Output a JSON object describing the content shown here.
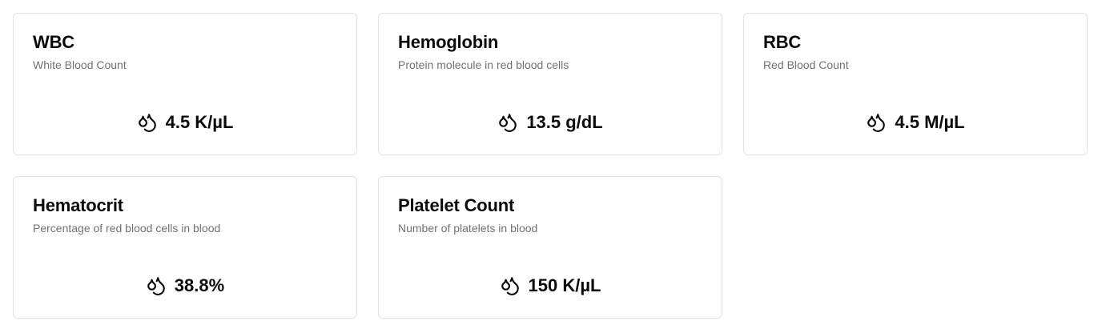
{
  "cards": [
    {
      "title": "WBC",
      "description": "White Blood Count",
      "value": "4.5 K/µL",
      "icon": "droplets-icon"
    },
    {
      "title": "Hemoglobin",
      "description": "Protein molecule in red blood cells",
      "value": "13.5 g/dL",
      "icon": "droplets-icon"
    },
    {
      "title": "RBC",
      "description": "Red Blood Count",
      "value": "4.5 M/µL",
      "icon": "droplets-icon"
    },
    {
      "title": "Hematocrit",
      "description": "Percentage of red blood cells in blood",
      "value": "38.8%",
      "icon": "droplets-icon"
    },
    {
      "title": "Platelet Count",
      "description": "Number of platelets in blood",
      "value": "150 K/µL",
      "icon": "droplets-icon"
    }
  ]
}
